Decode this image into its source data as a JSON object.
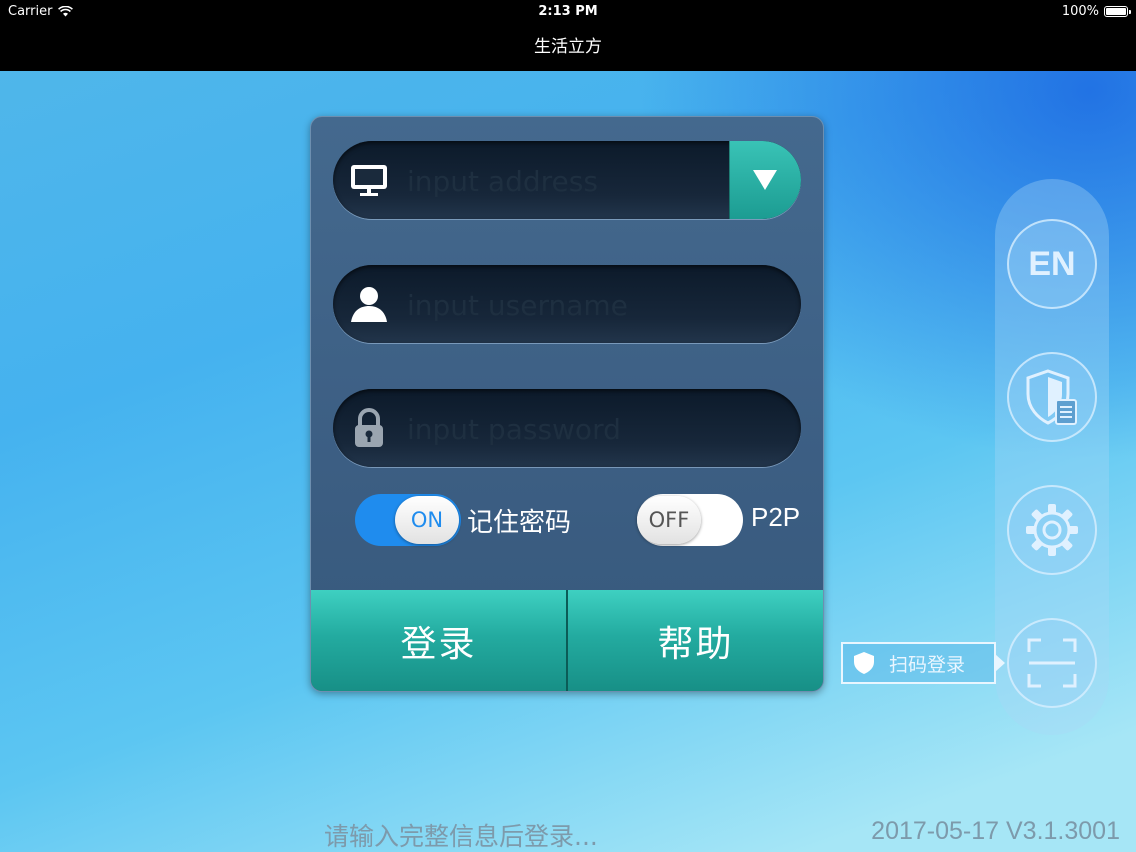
{
  "status_bar": {
    "carrier": "Carrier",
    "time": "2:13 PM",
    "battery": "100%"
  },
  "nav": {
    "title": "生活立方"
  },
  "form": {
    "address": {
      "placeholder": "input address",
      "icon": "monitor-icon"
    },
    "username": {
      "placeholder": "input username",
      "icon": "user-icon"
    },
    "password": {
      "placeholder": "input password",
      "icon": "lock-icon"
    },
    "remember": {
      "state_label": "ON",
      "label": "记住密码",
      "on": true
    },
    "p2p": {
      "state_label": "OFF",
      "label": "P2P",
      "on": false
    },
    "login_label": "登录",
    "help_label": "帮助"
  },
  "sidebar": {
    "language_label": "EN",
    "qr_login_label": "扫码登录"
  },
  "footer": {
    "status": "请输入完整信息后登录...",
    "version": "2017-05-17 V3.1.3001"
  },
  "colors": {
    "accent": "#2fbfb1",
    "toggle_on": "#1f8cee",
    "panel": "#3f6389"
  }
}
